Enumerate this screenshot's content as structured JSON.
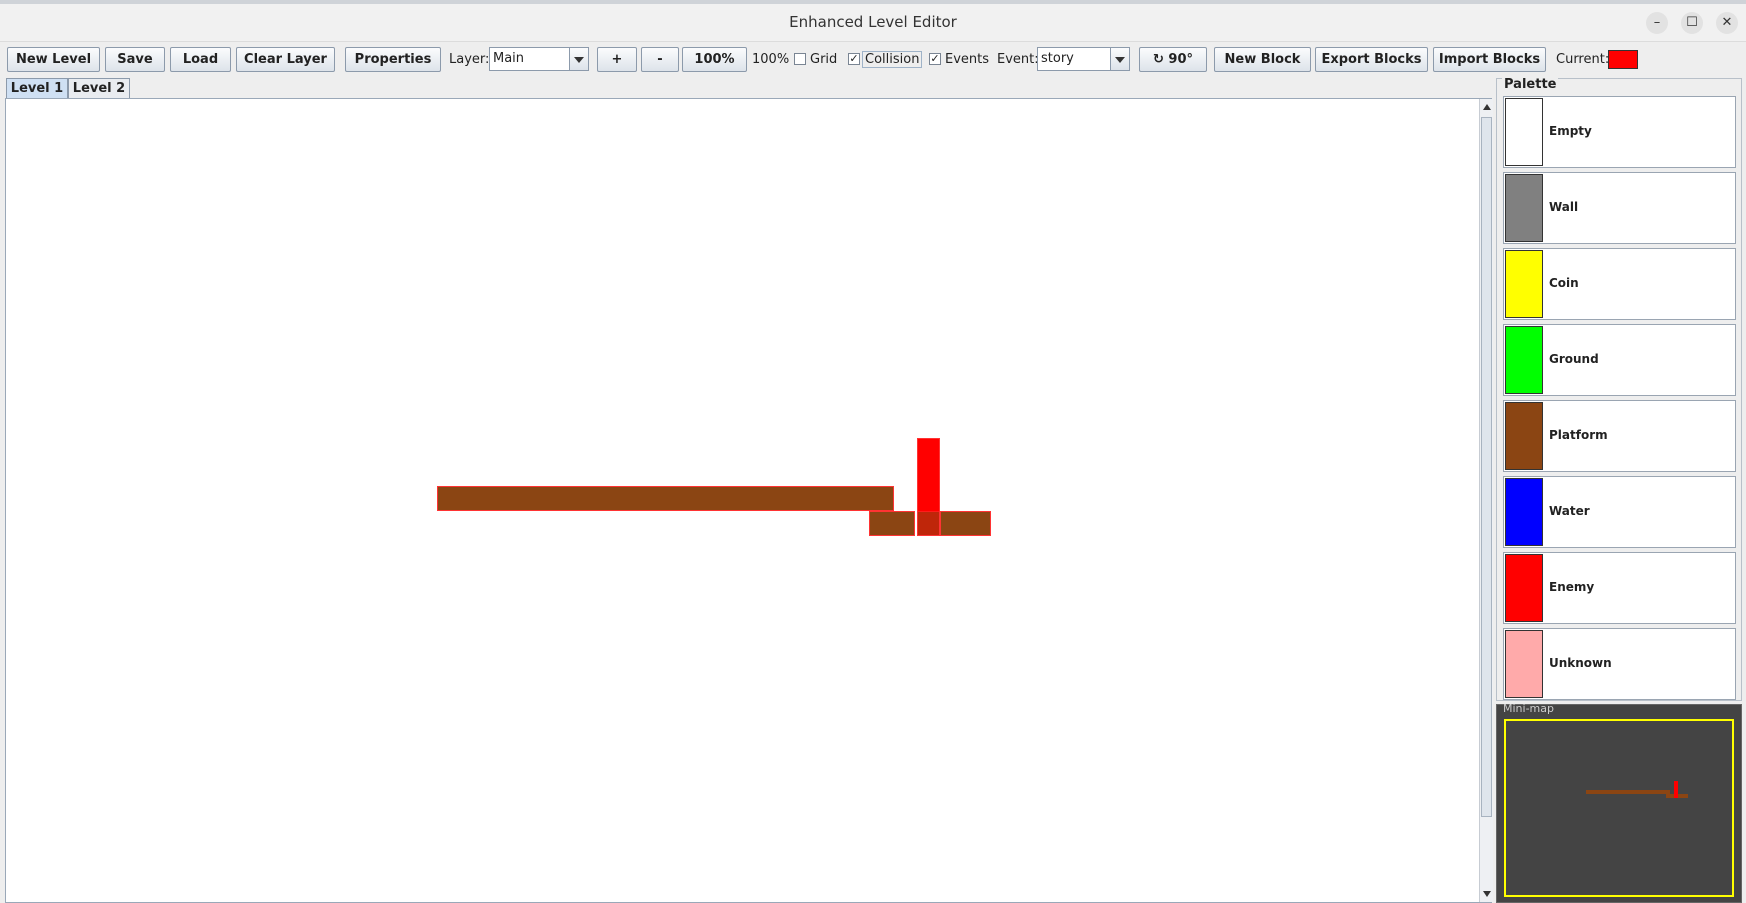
{
  "window": {
    "title": "Enhanced Level Editor",
    "controls": {
      "minimize": "–",
      "maximize": "☐",
      "close": "✕"
    }
  },
  "toolbar": {
    "new_level": "New Level",
    "save": "Save",
    "load": "Load",
    "clear_layer": "Clear Layer",
    "properties": "Properties",
    "layer_label": "Layer:",
    "layer_value": "Main",
    "zoom_in": "+",
    "zoom_out": "-",
    "zoom_reset": "100%",
    "zoom_readout": "100%",
    "grid_label": "Grid",
    "grid_checked": false,
    "collision_label": "Collision",
    "collision_checked": true,
    "events_label": "Events",
    "events_checked": true,
    "event_label": "Event:",
    "event_value": "story",
    "rotate": "↻ 90°",
    "new_block": "New Block",
    "export_blocks": "Export Blocks",
    "import_blocks": "Import Blocks",
    "current_label": "Current:",
    "current_color": "#ff0000",
    "check_mark": "✓"
  },
  "tabs": [
    {
      "label": "Level 1",
      "active": true
    },
    {
      "label": "Level 2",
      "active": false
    }
  ],
  "palette": {
    "title": "Palette",
    "items": [
      {
        "name": "Empty",
        "color": "#ffffff"
      },
      {
        "name": "Wall",
        "color": "#808080"
      },
      {
        "name": "Coin",
        "color": "#ffff00"
      },
      {
        "name": "Ground",
        "color": "#00ff00"
      },
      {
        "name": "Platform",
        "color": "#8b4513"
      },
      {
        "name": "Water",
        "color": "#0000ff"
      },
      {
        "name": "Enemy",
        "color": "#ff0000"
      },
      {
        "name": "Unknown",
        "color": "#ffaaaa"
      }
    ]
  },
  "level": {
    "platform_color": "#8b4513",
    "enemy_color": "#ff0000",
    "collision_outline": "#ff3333"
  },
  "minimap": {
    "title": "Mini-map",
    "viewport_color": "#ffff00",
    "background": "#444444"
  }
}
